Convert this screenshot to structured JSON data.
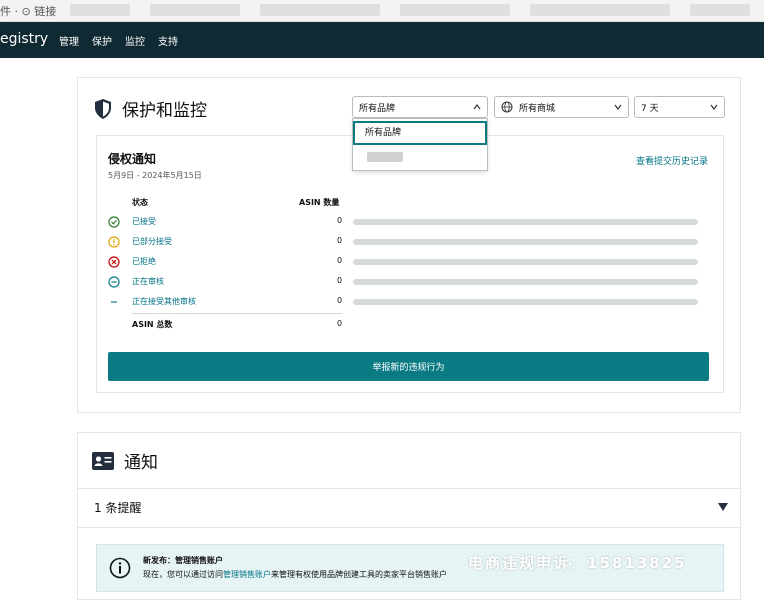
{
  "browser": {
    "crumb": "件 · ⊙ 链接"
  },
  "nav": {
    "brand": "egistry",
    "items": [
      "管理",
      "保护",
      "监控",
      "支持"
    ]
  },
  "protect": {
    "title": "保护和监控",
    "brand_select": "所有品牌",
    "store_select": "所有商城",
    "days_select": "7 天",
    "dropdown_option": "所有品牌"
  },
  "infringement": {
    "title": "侵权通知",
    "date_range": "5月9日 - 2024年5月15日",
    "history_link": "查看提交历史记录",
    "col_status": "状态",
    "col_asin": "ASIN 数量",
    "rows": [
      {
        "label": "已接受",
        "count": "0",
        "icon": "check-circle-icon",
        "color": "#2f8f2f"
      },
      {
        "label": "已部分接受",
        "count": "0",
        "icon": "exclamation-circle-icon",
        "color": "#e3a300"
      },
      {
        "label": "已拒绝",
        "count": "0",
        "icon": "x-circle-icon",
        "color": "#c40000"
      },
      {
        "label": "正在审核",
        "count": "0",
        "icon": "dash-circle-icon",
        "color": "#0a7b83"
      },
      {
        "label": "正在接受其他审核",
        "count": "0",
        "icon": "dash-icon",
        "color": "#0a7b83"
      }
    ],
    "total_label": "ASIN 总数",
    "total_value": "0",
    "report_button": "举报新的违规行为"
  },
  "notifications": {
    "title": "通知",
    "reminder": "1 条提醒",
    "notice_title": "新发布：管理销售账户",
    "notice_body_prefix": "现在，您可以通过访问",
    "notice_link": "管理销售账户",
    "notice_body_suffix": "来管理有权使用品牌创建工具的卖家平台销售账户"
  },
  "overlay": {
    "complaint": "电商违规申诉：15813825"
  },
  "colors": {
    "nav_bg": "#0f2a33",
    "accent": "#0a7b83",
    "link": "#007185"
  }
}
